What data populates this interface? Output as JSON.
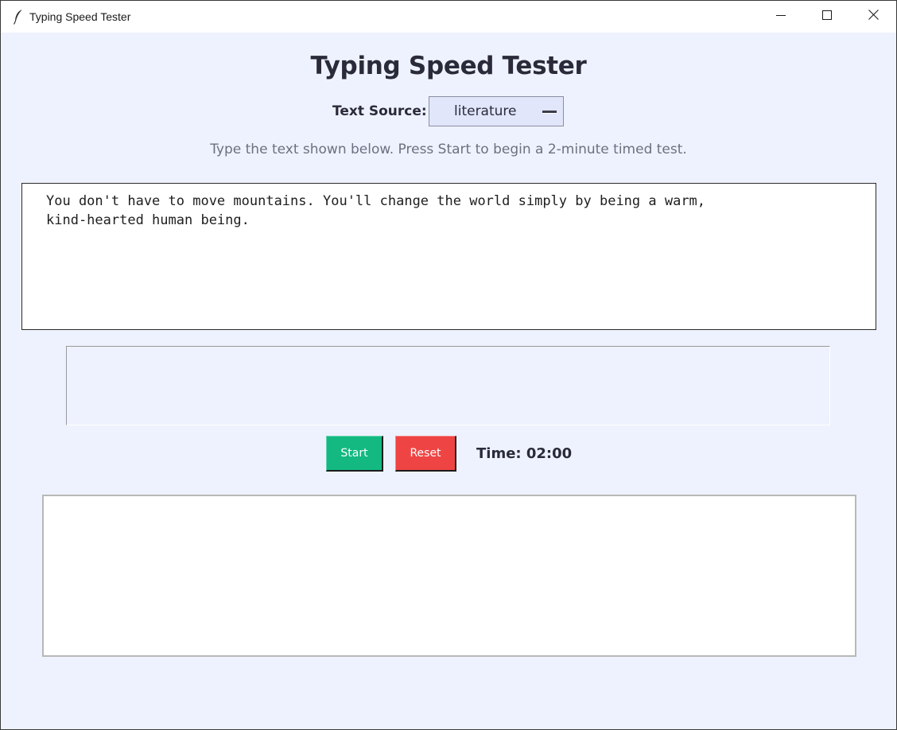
{
  "window": {
    "title": "Typing Speed Tester",
    "controls": {
      "minimize_icon": "minimize-icon",
      "maximize_icon": "maximize-icon",
      "close_icon": "close-icon"
    }
  },
  "header": {
    "title": "Typing Speed Tester"
  },
  "source": {
    "label": "Text Source:",
    "selected": "literature"
  },
  "instructions": "Type the text shown below. Press Start to begin a 2-minute timed test.",
  "sample": {
    "text": "You don't have to move mountains. You'll change the world simply by being a warm,\nkind-hearted human being."
  },
  "input": {
    "value": ""
  },
  "controls": {
    "start_label": "Start",
    "reset_label": "Reset",
    "timer": "Time: 02:00"
  },
  "results": {
    "text": ""
  },
  "colors": {
    "background": "#eef2fe",
    "start": "#13b981",
    "reset": "#ef4444",
    "heading": "#2a2a3a",
    "muted": "#6b7180"
  }
}
